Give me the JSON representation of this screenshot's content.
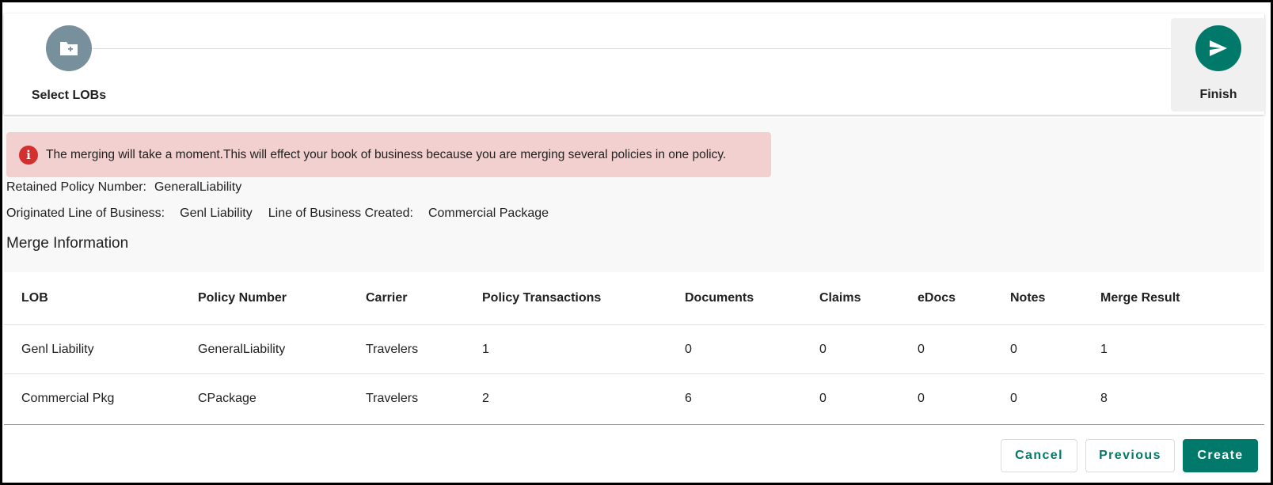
{
  "stepper": {
    "steps": [
      {
        "label": "Select LOBs",
        "icon": "folder-plus-icon"
      },
      {
        "label": "Finish",
        "icon": "send-icon"
      }
    ]
  },
  "alert": {
    "icon": "info-icon",
    "icon_glyph": "i",
    "message": "The merging will take a moment.This will effect your book of business because you are merging several policies in one policy."
  },
  "summary": {
    "retained_label": "Retained Policy Number:",
    "retained_value": "GeneralLiability",
    "originated_label": "Originated Line of Business:",
    "originated_value": "Genl Liability",
    "created_label": "Line of Business Created:",
    "created_value": "Commercial Package"
  },
  "merge_title": "Merge Information",
  "table": {
    "columns": [
      "LOB",
      "Policy Number",
      "Carrier",
      "Policy Transactions",
      "Documents",
      "Claims",
      "eDocs",
      "Notes",
      "Merge Result"
    ],
    "rows": [
      [
        "Genl Liability",
        "GeneralLiability",
        "Travelers",
        "1",
        "0",
        "0",
        "0",
        "0",
        "1"
      ],
      [
        "Commercial Pkg",
        "CPackage",
        "Travelers",
        "2",
        "6",
        "0",
        "0",
        "0",
        "8"
      ]
    ]
  },
  "actions": {
    "cancel": "Cancel",
    "previous": "Previous",
    "create": "Create"
  },
  "colors": {
    "accent": "#00796b",
    "step_inactive": "#78909c",
    "alert_bg": "#f2d0cf",
    "alert_icon": "#d32f2f"
  }
}
